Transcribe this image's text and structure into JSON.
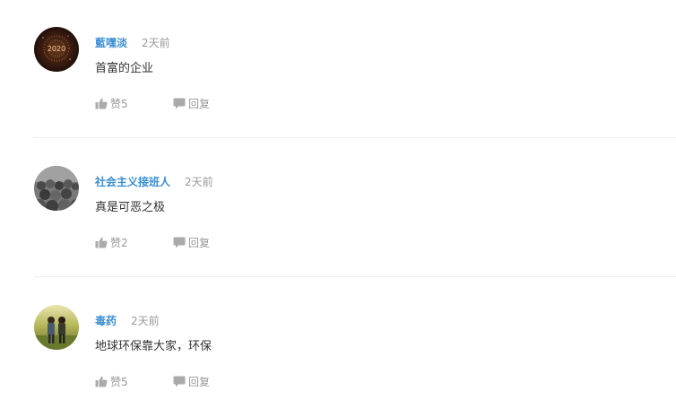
{
  "comments": [
    {
      "author": "藍嘿淡",
      "time": "2天前",
      "content": "首富的企业",
      "like_label": "赞5",
      "reply_label": "回复",
      "avatar_icon": "firework-2020-avatar"
    },
    {
      "author": "社会主义接班人",
      "time": "2天前",
      "content": "真是可恶之极",
      "like_label": "赞2",
      "reply_label": "回复",
      "avatar_icon": "crowd-photo-avatar"
    },
    {
      "author": "毒药",
      "time": "2天前",
      "content": "地球环保靠大家，环保",
      "like_label": "赞5",
      "reply_label": "回复",
      "avatar_icon": "outdoor-couple-avatar"
    }
  ],
  "colors": {
    "author": "#3a8ed4",
    "meta": "#999999",
    "text": "#333333",
    "divider": "#eeeeee"
  }
}
